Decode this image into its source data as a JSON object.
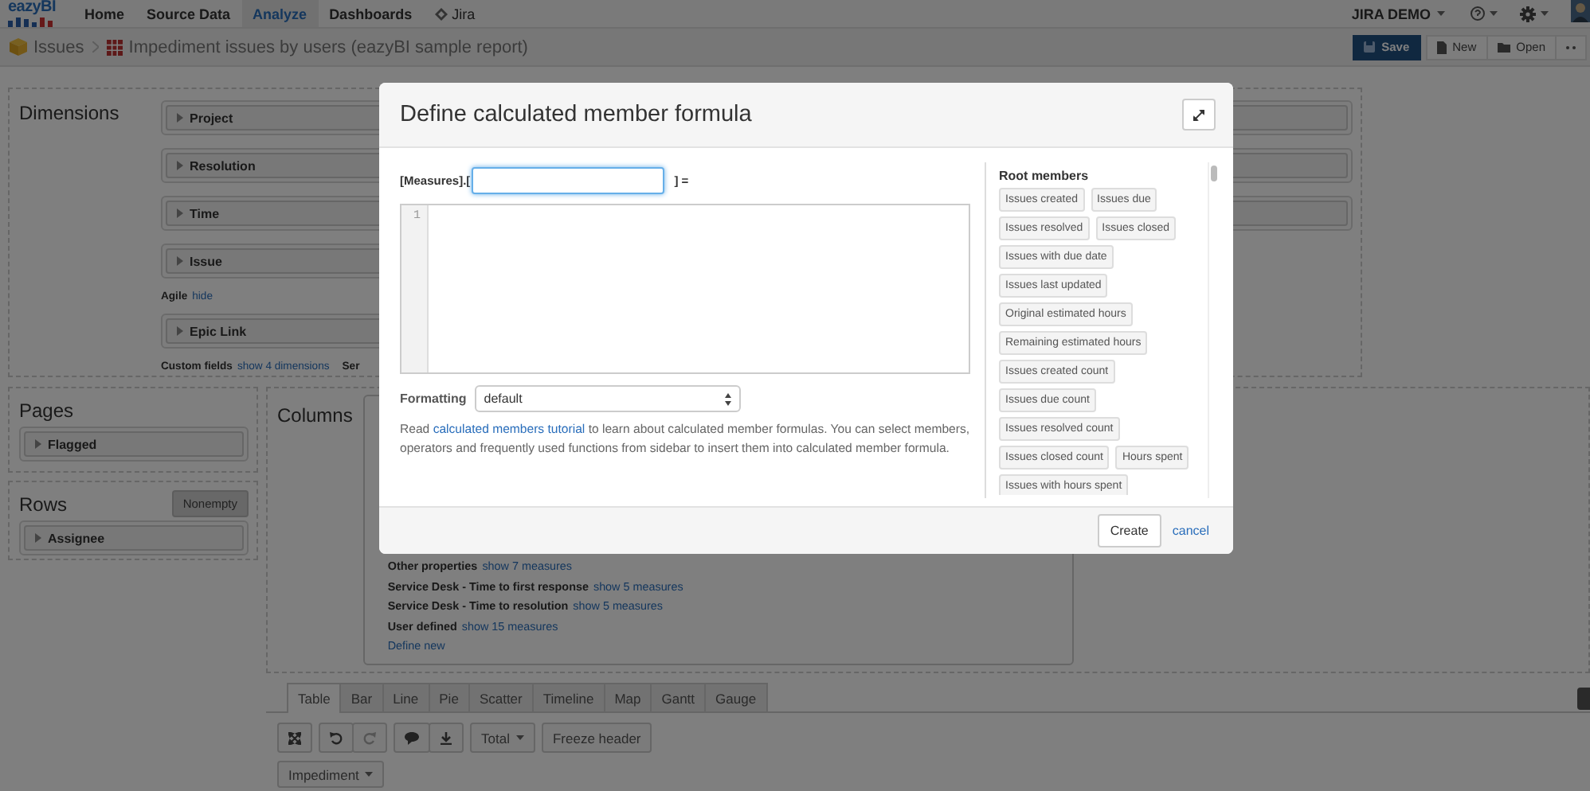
{
  "nav": {
    "logo": "eazyBI",
    "items": [
      {
        "label": "Home",
        "kind": "page",
        "selected": false
      },
      {
        "label": "Source Data",
        "kind": "page",
        "selected": false
      },
      {
        "label": "Analyze",
        "kind": "page",
        "selected": true
      },
      {
        "label": "Dashboards",
        "kind": "page",
        "selected": false
      },
      {
        "label": "Jira",
        "kind": "app",
        "selected": false
      }
    ],
    "account": "JIRA DEMO"
  },
  "breadcrumb": {
    "section": "Issues",
    "report": "Impediment issues by users (eazyBI sample report)"
  },
  "report_actions": [
    {
      "label": "Save",
      "kind": "save"
    },
    {
      "label": "New",
      "kind": "new"
    },
    {
      "label": "Open",
      "kind": "open"
    }
  ],
  "dimensions": {
    "title": "Dimensions",
    "items": [
      {
        "kind": "dimension",
        "label": "Project"
      },
      {
        "kind": "dimension",
        "label": "Resolution"
      },
      {
        "kind": "dimension",
        "label": "Time"
      },
      {
        "kind": "dimension",
        "label": "Issue"
      },
      {
        "kind": "note",
        "label": "Agile",
        "link": "hide"
      },
      {
        "kind": "dimension",
        "label": "Epic Link"
      },
      {
        "kind": "note",
        "label": "Custom fields",
        "link": "show 4 dimensions",
        "after": "Ser"
      }
    ]
  },
  "pages": {
    "title": "Pages",
    "items": [
      "Flagged"
    ]
  },
  "rows": {
    "title": "Rows",
    "button": "Nonempty",
    "items": [
      "Assignee"
    ]
  },
  "columns": {
    "title": "Columns",
    "measure_groups": [
      {
        "label": "Other properties",
        "link": "show 7 measures"
      },
      {
        "label": "Service Desk - Time to first response",
        "link": "show 5 measures"
      },
      {
        "label": "Service Desk - Time to resolution",
        "link": "show 5 measures"
      },
      {
        "label": "User defined",
        "link": "show 15 measures"
      }
    ],
    "define_link": "Define new"
  },
  "view_tabs": [
    {
      "label": "Table",
      "selected": true
    },
    {
      "label": "Bar",
      "selected": false
    },
    {
      "label": "Line",
      "selected": false
    },
    {
      "label": "Pie",
      "selected": false
    },
    {
      "label": "Scatter",
      "selected": false
    },
    {
      "label": "Timeline",
      "selected": false
    },
    {
      "label": "Map",
      "selected": false
    },
    {
      "label": "Gantt",
      "selected": false
    },
    {
      "label": "Gauge",
      "selected": false
    }
  ],
  "toolbar": {
    "total": "Total",
    "freeze": "Freeze header",
    "filter": "Impediment"
  },
  "modal": {
    "title": "Define calculated member formula",
    "name_prefix": "[Measures].[",
    "name_suffix": "] =",
    "name_focused": true,
    "line_numbers": [
      "1"
    ],
    "formatting_label": "Formatting",
    "formatting_value": "default",
    "help_before": "Read ",
    "help_link": "calculated members tutorial",
    "help_after": " to learn about calculated member formulas. You can select members, operators and frequently used functions from sidebar to insert them into calculated member formula.",
    "sidebar_title": "Root members",
    "members": [
      "Issues created",
      "Issues due",
      "Issues resolved",
      "Issues closed",
      "Issues with due date",
      "Issues last updated",
      "Original estimated hours",
      "Remaining estimated hours",
      "Issues created count",
      "Issues due count",
      "Issues resolved count",
      "Issues closed count",
      "Hours spent",
      "Issues with hours spent"
    ],
    "create": "Create",
    "cancel": "cancel"
  }
}
